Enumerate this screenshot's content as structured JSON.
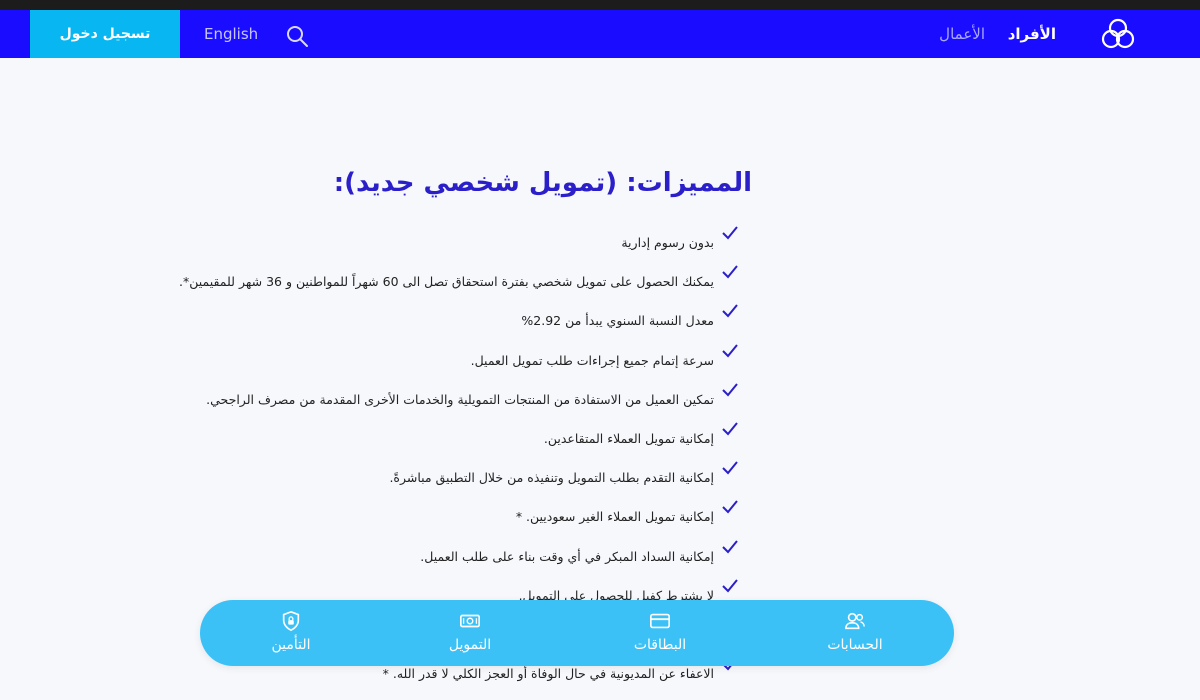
{
  "colors": {
    "brand_blue": "#1a0dff",
    "login_bg": "#08b7f2",
    "title": "#2a1fc9",
    "bottom_bar": "#3cc1f7",
    "check": "#2a1fc9"
  },
  "header": {
    "logo_icon": "three-circles-logo-icon",
    "nav_individuals": "الأفراد",
    "nav_business": "الأعمال",
    "search_icon": "search-icon",
    "language": "English",
    "login": "تسجيل دخول"
  },
  "main": {
    "title": "المميزات: (تمويل شخصي جديد):",
    "check_icon": "check-icon",
    "features": [
      "بدون رسوم إدارية",
      "يمكنك الحصول على تمويل شخصي بفترة استحقاق تصل الى 60 شهراً للمواطنين و 36 شهر للمقيمين*.",
      "معدل النسبة السنوي يبدأ من 2.92%",
      "سرعة إتمام جميع إجراءات طلب تمويل العميل.",
      "تمكين العميل من الاستفادة من المنتجات التمويلية والخدمات الأخرى المقدمة من مصرف الراجحي.",
      "إمكانية تمويل العملاء المتقاعدين.",
      "إمكانية التقدم بطلب التمويل وتنفيذه من خلال التطبيق مباشرةً.",
      "إمكانية تمويل العملاء الغير سعوديين. *",
      "إمكانية السداد المبكر في أي وقت بناء على طلب العميل.",
      "لا يشترط كفيل للحصول على التمويل.",
      "",
      "الاعفاء عن المديونية في حال الوفاة أو العجز الكلي لا قدر الله. *"
    ]
  },
  "bottom_nav": {
    "accounts": {
      "label": "الحسابات",
      "icon": "users-icon"
    },
    "cards": {
      "label": "البطاقات",
      "icon": "card-icon"
    },
    "finance": {
      "label": "التمويل",
      "icon": "banknote-icon"
    },
    "insurance": {
      "label": "التأمين",
      "icon": "shield-lock-icon"
    }
  }
}
